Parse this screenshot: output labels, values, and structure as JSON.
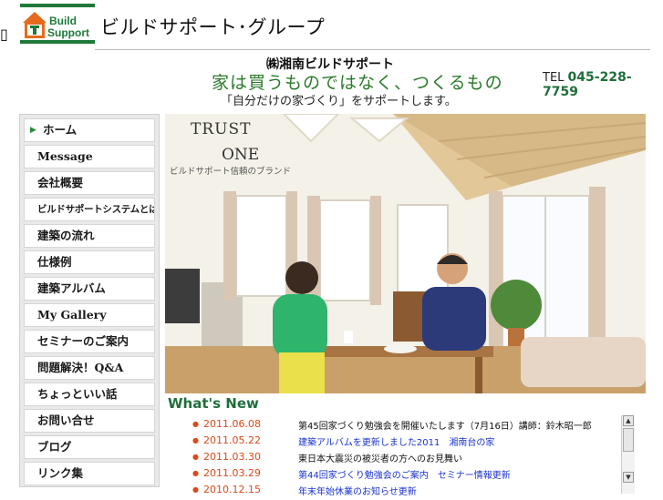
{
  "header": {
    "logo_line1": "Build",
    "logo_line2": "Support",
    "logo_icon": "house-t-icon",
    "missing_glyph": "▯",
    "site_title": "ビルドサポート･グループ",
    "company": "㈱湘南ビルドサポート",
    "tagline": "家は買うものではなく、つくるもの",
    "subtag": "「自分だけの家づくり」をサポートします。",
    "tel_label": "TEL",
    "tel_number": "045-228-7759"
  },
  "menu": {
    "items": [
      {
        "label": "ホーム",
        "active": true
      },
      {
        "label": "Message"
      },
      {
        "label": "会社概要"
      },
      {
        "label": "ビルドサポートシステムとは"
      },
      {
        "label": "建築の流れ"
      },
      {
        "label": "仕様例"
      },
      {
        "label": "建築アルバム"
      },
      {
        "label": "My Gallery"
      },
      {
        "label": "セミナーのご案内"
      },
      {
        "label": "問題解決！Q&A"
      },
      {
        "label": "ちょっといい話"
      },
      {
        "label": "お問い合せ"
      },
      {
        "label": "ブログ"
      },
      {
        "label": "リンク集"
      }
    ]
  },
  "hero": {
    "brand_line1": "TRUST",
    "brand_line2": "ONE",
    "brand_caption": "ビルドサポート信頼のブランド"
  },
  "whats_new": {
    "title": "What's New",
    "items": [
      {
        "date": "2011.06.08",
        "text": "第45回家づくり勉強会を開催いたします（7月16日）講師：鈴木昭一郎",
        "link": false
      },
      {
        "date": "2011.05.22",
        "text": "建築アルバムを更新しました2011　湘南台の家",
        "link": true
      },
      {
        "date": "2011.03.30",
        "text": "東日本大震災の被災者の方へのお見舞い",
        "link": false
      },
      {
        "date": "2011.03.29",
        "text": "第44回家づくり勉強会のご案内　セミナー情報更新",
        "link": true
      },
      {
        "date": "2010.12.15",
        "text": "年末年始休業のお知らせ更新",
        "link": true
      }
    ]
  },
  "colors": {
    "accent_green": "#1f6f3a",
    "date_orange": "#d94a1a",
    "link_blue": "#1a33cc"
  }
}
